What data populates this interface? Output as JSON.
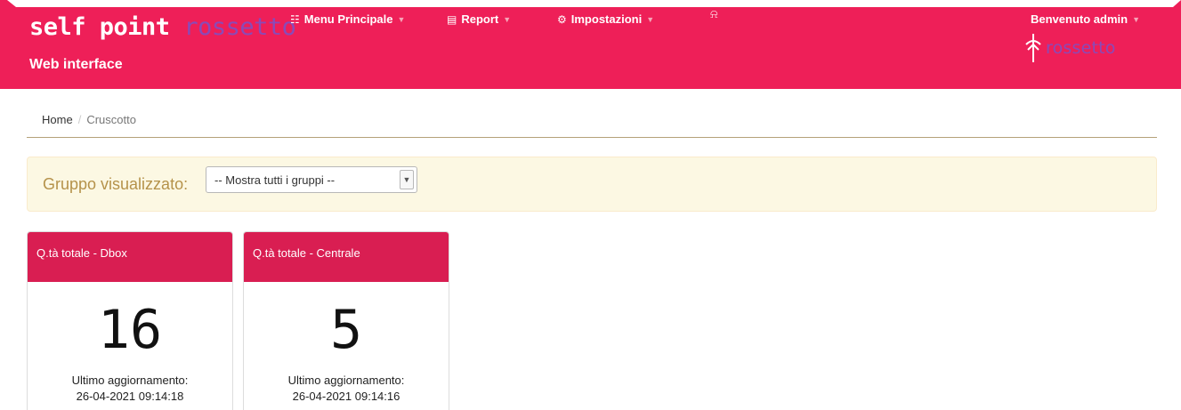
{
  "header": {
    "brand_primary": "self point",
    "brand_accent": "rossetto",
    "subtitle": "Web interface",
    "nav": [
      {
        "icon": "sitemap-icon",
        "label": "Menu Principale"
      },
      {
        "icon": "chart-icon",
        "label": "Report"
      },
      {
        "icon": "gear-icon",
        "label": "Impostazioni"
      }
    ],
    "bell_icon": "bell-icon",
    "user_greeting": "Benvenuto admin",
    "logo_text": "rossetto",
    "colors": {
      "bar": "#ee1f58",
      "accent": "#8a4ab8"
    }
  },
  "breadcrumb": {
    "home": "Home",
    "current": "Cruscotto"
  },
  "filter": {
    "label": "Gruppo visualizzato:",
    "select_value": "-- Mostra tutti i gruppi --"
  },
  "cards": [
    {
      "title": "Q.tà totale - Dbox",
      "value": "16",
      "meta_label": "Ultimo aggiornamento:",
      "meta_time": "26-04-2021 09:14:18"
    },
    {
      "title": "Q.tà totale - Centrale",
      "value": "5",
      "meta_label": "Ultimo aggiornamento:",
      "meta_time": "26-04-2021 09:14:16"
    }
  ]
}
